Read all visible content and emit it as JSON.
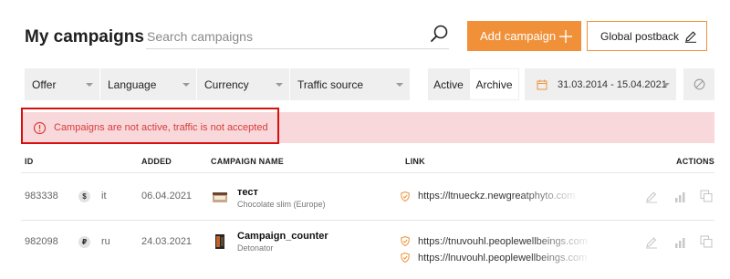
{
  "header": {
    "title": "My campaigns",
    "search_placeholder": "Search campaigns",
    "add_campaign_label": "Add campaign",
    "global_postback_label": "Global postback"
  },
  "filters": [
    {
      "label": "Offer"
    },
    {
      "label": "Language"
    },
    {
      "label": "Currency"
    },
    {
      "label": "Traffic source"
    }
  ],
  "status_tabs": {
    "active_label": "Active",
    "archive_label": "Archive",
    "selected": "Archive"
  },
  "date_range": "31.03.2014 - 15.04.2021",
  "alert": {
    "text": "Campaigns are not active, traffic is not accepted",
    "color": "#d93b3b",
    "background": "#f8d8da"
  },
  "table": {
    "columns": [
      "ID",
      "ADDED",
      "CAMPAIGN NAME",
      "LINK",
      "ACTIONS"
    ],
    "rows": [
      {
        "id": "983338",
        "currency": "$",
        "lang": "it",
        "added": "06.04.2021",
        "name": "тест",
        "offer": "Chocolate slim (Europe)",
        "links": [
          "https://ltnueckz.newgreatphyto.com"
        ]
      },
      {
        "id": "982098",
        "currency": "₽",
        "lang": "ru",
        "added": "24.03.2021",
        "name": "Campaign_counter",
        "offer": "Detonator",
        "links": [
          "https://tnuvouhl.peoplewellbeings.com",
          "https://lnuvouhl.peoplewellbeings.com"
        ]
      }
    ]
  },
  "colors": {
    "accent": "#f0913a",
    "alert_border": "#d80f0f",
    "filter_bg": "#efefef"
  },
  "icons": [
    "search-icon",
    "plus-icon",
    "pen-icon",
    "calendar-icon",
    "reset-icon",
    "alert-circle-icon",
    "shield-icon",
    "edit-icon",
    "stats-icon",
    "copy-icon"
  ]
}
